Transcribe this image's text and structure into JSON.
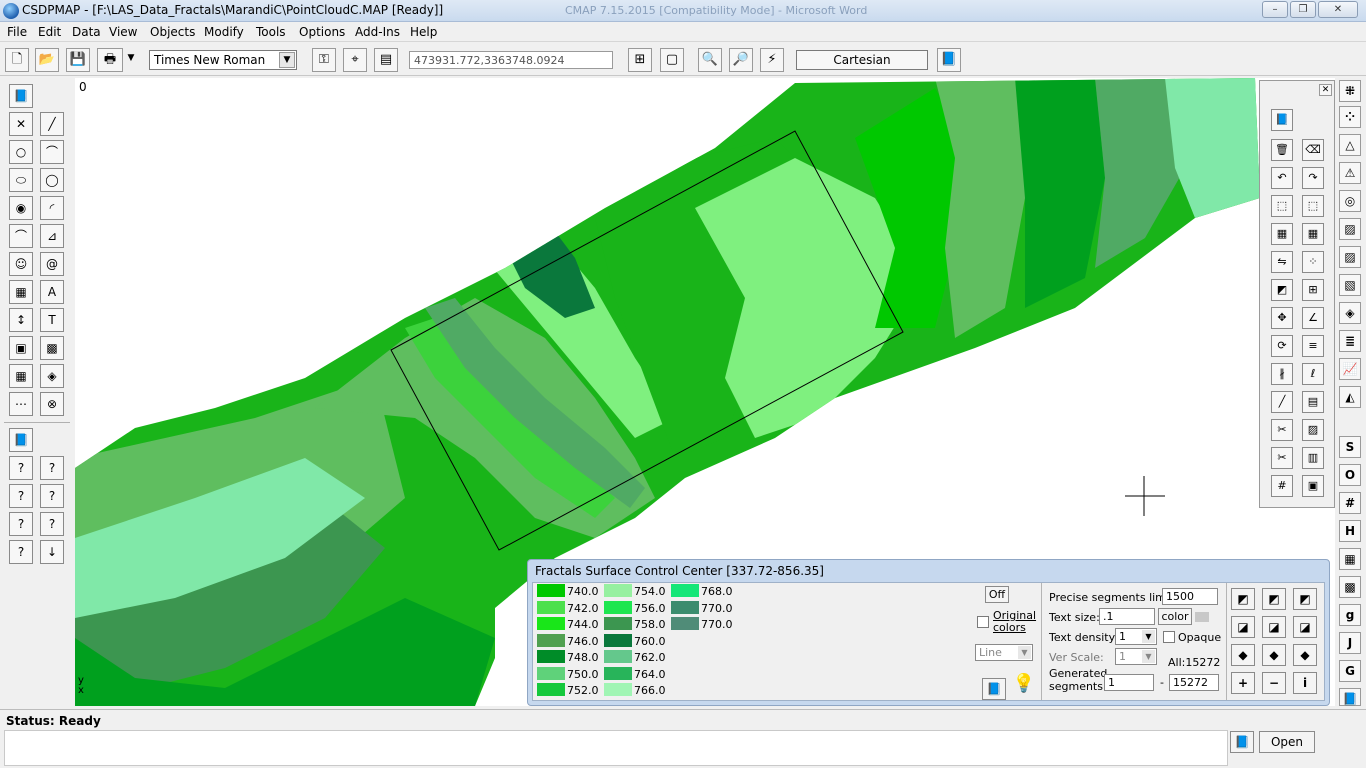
{
  "window": {
    "title": "CSDPMAP - [F:\\LAS_Data_Fractals\\MarandiC\\PointCloudC.MAP [Ready]]",
    "background_title": "CMAP 7.15.2015 [Compatibility Mode] - Microsoft Word",
    "minimize": "–",
    "maximize": "❐",
    "close": "✕"
  },
  "menu": [
    "File",
    "Edit",
    "Data",
    "View",
    "Objects",
    "Modify",
    "Tools",
    "Options",
    "Add-Ins",
    "Help"
  ],
  "toolbar": {
    "font": "Times New Roman",
    "coordinates": "473931.772,3363748.0924",
    "coord_system": "Cartesian"
  },
  "canvas": {
    "origin_label": "0",
    "axis_y": "y",
    "axis_x": "x",
    "colors": {
      "c1": "#00c800",
      "c2": "#19b419",
      "c3": "#5fbe5f",
      "c4": "#7ff07f",
      "c5": "#00a01e",
      "c6": "#3cd23c",
      "c7": "#50aa64",
      "c8": "#80e8a8"
    }
  },
  "control_center": {
    "title": "Fractals Surface Control Center [337.72-856.35]",
    "legend": [
      {
        "value": "740.0",
        "color": "#00c800"
      },
      {
        "value": "742.0",
        "color": "#4ce04c"
      },
      {
        "value": "744.0",
        "color": "#19e619"
      },
      {
        "value": "746.0",
        "color": "#50a050"
      },
      {
        "value": "748.0",
        "color": "#008c28"
      },
      {
        "value": "750.0",
        "color": "#5fd27a"
      },
      {
        "value": "752.0",
        "color": "#14c83c"
      },
      {
        "value": "754.0",
        "color": "#96f0a0"
      },
      {
        "value": "756.0",
        "color": "#1ee650"
      },
      {
        "value": "758.0",
        "color": "#3c9650"
      },
      {
        "value": "760.0",
        "color": "#0a783c"
      },
      {
        "value": "762.0",
        "color": "#64c88c"
      },
      {
        "value": "764.0",
        "color": "#28b45a"
      },
      {
        "value": "766.0",
        "color": "#a0f5b4"
      },
      {
        "value": "768.0",
        "color": "#14e678"
      },
      {
        "value": "770.0",
        "color": "#3c8c6e"
      },
      {
        "value": "770.0",
        "color": "#508c78"
      }
    ],
    "off_label": "Off",
    "original_colors_label_1": "Original",
    "original_colors_label_2": "colors",
    "line_mode": "Line",
    "precise_segments_label": "Precise segments limit:",
    "precise_segments_value": "1500",
    "text_size_label": "Text size:",
    "text_size_value": ".1",
    "color_button": "color",
    "text_density_label": "Text density:",
    "text_density_value": "1",
    "opaque_label": "Opaque",
    "ver_scale_label": "Ver Scale:",
    "ver_scale_value": "1",
    "all_label": "All:15272",
    "generated_label_1": "Generated",
    "generated_label_2": "segments:",
    "generated_from": "1",
    "generated_dash": "-",
    "generated_to": "15272",
    "plus": "+",
    "minus": "−",
    "info": "i"
  },
  "status": {
    "label": "Status: Ready",
    "open_button": "Open"
  },
  "right_letters": {
    "s": "S",
    "o": "O",
    "h": "H",
    "g": "G"
  }
}
